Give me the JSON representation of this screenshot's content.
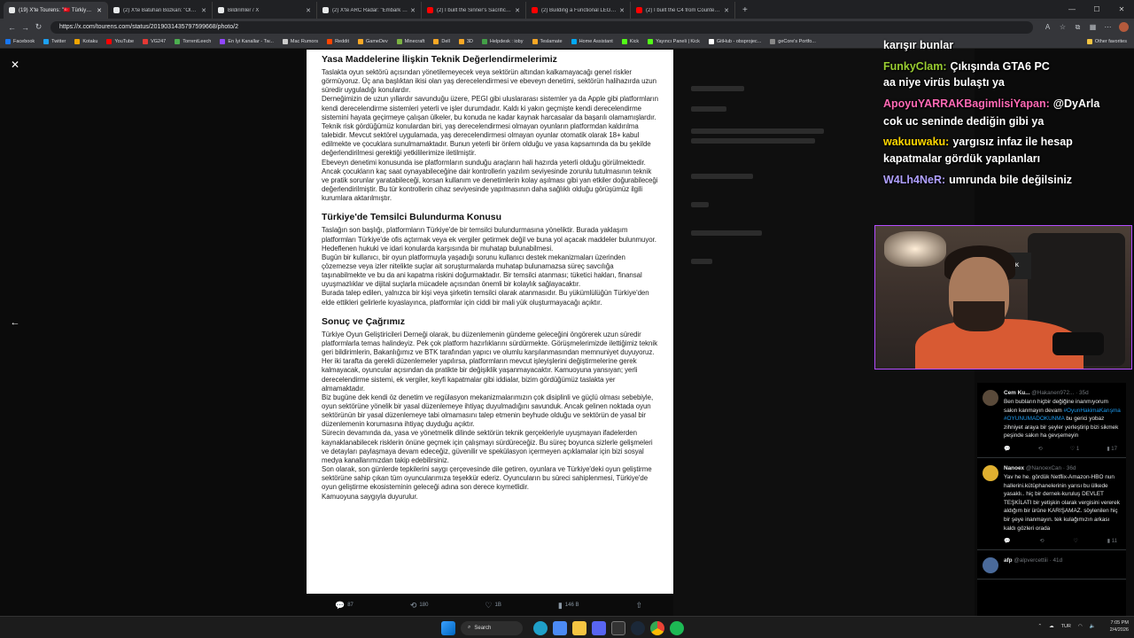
{
  "browser": {
    "tabs": [
      {
        "title": "(19) X'te Tourens: \"🇹🇷 Türkiye Oyun...",
        "active": true,
        "color": "#000000"
      },
      {
        "title": "(2) X'te Batuhan Bozkan: \"Olumlu...",
        "color": "#000000"
      },
      {
        "title": "Bildirimler / X",
        "color": "#000000"
      },
      {
        "title": "(2) X'te ARC Radar: \"Embark Studi...",
        "color": "#000000"
      },
      {
        "title": "(2) I built the Sinner's Sacrifice fro...",
        "color": "#ff0000"
      },
      {
        "title": "(2) Building a Functional LEGO Ty...",
        "color": "#ff0000"
      },
      {
        "title": "(2) I built the C4 from Counter-Str...",
        "color": "#ff0000"
      }
    ],
    "new_tab": "+",
    "url": "https://x.com/tourens.com/status/2019031435797599668/photo/2",
    "bookmarks": [
      {
        "label": "Facebook",
        "color": "#1877f2"
      },
      {
        "label": "Twitter",
        "color": "#1da1f2"
      },
      {
        "label": "Kotaku",
        "color": "#f0a500"
      },
      {
        "label": "YouTube",
        "color": "#ff0000"
      },
      {
        "label": "VG247",
        "color": "#e53935"
      },
      {
        "label": "TorrentLeech",
        "color": "#4caf50"
      },
      {
        "label": "En İyi Kanallar - Tw...",
        "color": "#9146ff"
      },
      {
        "label": "Mac Rumors",
        "color": "#cccccc"
      },
      {
        "label": "Reddit",
        "color": "#ff4500"
      },
      {
        "label": "GameDev",
        "color": "#f9a825"
      },
      {
        "label": "Minecraft",
        "color": "#7cb342"
      },
      {
        "label": "Dell",
        "color": "#f9a825"
      },
      {
        "label": "3D",
        "color": "#f9a825"
      },
      {
        "label": "Helpdesk : ioby",
        "color": "#43a047"
      },
      {
        "label": "Teslamate",
        "color": "#f9a825"
      },
      {
        "label": "Home Assistant",
        "color": "#03a9f4"
      },
      {
        "label": "Kick",
        "color": "#53fc18"
      },
      {
        "label": "Yayıncı Paneli | Kick",
        "color": "#53fc18"
      },
      {
        "label": "GitHub - obsprojec...",
        "color": "#ffffff"
      },
      {
        "label": "geCore's Portfo...",
        "color": "#888888"
      }
    ],
    "other_bookmarks": "Other favorites"
  },
  "document": {
    "sections": [
      {
        "heading": "Yasa Maddelerine İlişkin Teknik Değerlendirmelerimiz",
        "paragraphs": [
          "Taslakta oyun sektörü açısından yönetilemeyecek veya sektörün altından kalkamayacağı genel riskler görmüyoruz. Üç ana başlıktan ikisi olan yaş derecelendirmesi ve ebeveyn denetimi, sektörün halihazırda uzun süredir uyguladığı konulardır.",
          "Derneğimizin de uzun yıllardır savunduğu üzere, PEGI gibi uluslararası sistemler ya da Apple gibi platformların kendi derecelendirme sistemleri yeterli ve işler durumdadır. Kaldı ki yakın geçmişte kendi derecelendirme sistemini hayata geçirmeye çalışan ülkeler, bu konuda ne kadar kaynak harcasalar da başarılı olamamışlardır.",
          "Teknik risk gördüğümüz konulardan biri, yaş derecelendirmesi olmayan oyunların platformdan kaldırılma talebidir. Mevcut sektörel uygulamada, yaş derecelendirmesi olmayan oyunlar otomatik olarak 18+ kabul edilmekte ve çocuklara sunulmamaktadır. Bunun yeterli bir önlem olduğu ve yasa kapsamında da bu şekilde değerlendirilmesi gerektiği yetkililerimize iletilmiştir.",
          "Ebeveyn denetimi konusunda ise platformların sunduğu araçların hali hazırda yeterli olduğu görülmektedir. Ancak çocukların kaç saat oynayabileceğine dair kontrollerin yazılım seviyesinde zorunlu tutulmasının teknik ve pratik sorunlar yaratabileceği, korsan kullanım ve denetimlerin kolay aşılması gibi yan etkiler doğurabileceği değerlendirilmiştir. Bu tür kontrollerin cihaz seviyesinde yapılmasının daha sağlıklı olduğu görüşümüz ilgili kurumlara aktarılmıştır."
        ]
      },
      {
        "heading": "Türkiye'de Temsilci Bulundurma Konusu",
        "paragraphs": [
          "Taslağın son başlığı, platformların Türkiye'de bir temsilci bulundurmasına yöneliktir. Burada yaklaşım platformları Türkiye'de ofis açtırmak veya ek vergiler getirmek değil ve buna yol açacak maddeler bulunmuyor. Hedeflenen hukuki ve idari konularda karşısında bir muhatap bulunabilmesi.",
          "Bugün bir kullanıcı, bir oyun platformuyla yaşadığı sorunu kullanıcı destek mekanizmaları üzerinden çözemezse veya izler nitelikte suçlar ait soruşturmalarda muhatap bulunamazsa süreç savcılığa taşınabilmekte ve bu da ani kapatma riskini doğurmaktadır. Bir temsilci atanması; tüketici hakları, finansal uyuşmazlıklar ve dijital suçlarla mücadele açısından önemli bir kolaylık sağlayacaktır.",
          "Burada talep edilen, yalnızca bir kişi veya şirketin temsilci olarak atanmasıdır. Bu yükümlülüğün Türkiye'den elde ettikleri gelirlerle kıyaslayınca, platformlar için ciddi bir mali yük oluşturmayacağı açıktır."
        ]
      },
      {
        "heading": "Sonuç ve Çağrımız",
        "paragraphs": [
          "Türkiye Oyun Geliştiricileri Derneği olarak, bu düzenlemenin gündeme geleceğini öngörerek uzun süredir platformlarla temas halindeyiz. Pek çok platform hazırlıklarını sürdürmekte. Görüşmelerimizde ilettiğimiz teknik geri bildirimlerin, Bakanlığımız ve BTK tarafından yapıcı ve olumlu karşılanmasından memnuniyet duyuyoruz.",
          "Her iki tarafta da gerekli düzenlemeler yapılırsa, platformların mevcut işleyişlerini değiştirmelerine gerek kalmayacak, oyuncular açısından da pratikte bir değişiklik yaşanmayacaktır. Kamuoyuna yansıyan; yerli derecelendirme sistemi, ek vergiler, keyfi kapatmalar gibi iddialar, bizim gördüğümüz taslakta yer almamaktadır.",
          "Biz bugüne dek kendi öz denetim ve regülasyon mekanizmalarımızın çok disiplinli ve güçlü olması sebebiyle, oyun sektörüne yönelik bir yasal düzenlemeye ihtiyaç duyulmadığını savunduk. Ancak gelinen noktada oyun sektörünün bir yasal düzenlemeye tabi olmamasını talep etmenin beyhude olduğu ve sektörün de yasal bir düzenlemenin korumasına ihtiyaç duyduğu açıktır.",
          "Sürecin devamında da, yasa ve yönetmelik dilinde sektörün teknik gerçekleriyle uyuşmayan ifadelerden kaynaklanabilecek risklerin önüne geçmek için çalışmayı sürdüreceğiz. Bu süreç boyunca sizlerle gelişmeleri ve detayları paylaşmaya devam edeceğiz, güvenilir ve spekülasyon içermeyen açıklamalar için bizi sosyal medya kanallarımızdan takip edebilirsiniz.",
          "Son olarak, son günlerde tepkilerini saygı çerçevesinde dile getiren, oyunlara ve Türkiye'deki oyun geliştirme sektörüne sahip çıkan tüm oyuncularımıza teşekkür ederiz. Oyuncuların bu süreci sahiplenmesi, Türkiye'de oyun geliştirme ekosisteminin geleceği adına son derece kıymetlidir.",
          "Kamuoyuna saygıyla duyurulur."
        ]
      }
    ]
  },
  "tweet_actions": {
    "replies": "87",
    "retweets": "180",
    "likes": "1B",
    "views": "146 B"
  },
  "chat": [
    {
      "user": "",
      "message": "karışır bunlar",
      "color": "#ffffff"
    },
    {
      "user": "FunkyClam:",
      "message": "Çıkışında GTA6 PC",
      "color": "#9acd32"
    },
    {
      "user": "",
      "message": "aa niye virüs bulaştı ya",
      "color": "#ffffff"
    },
    {
      "user": "ApoyuYARRAKBagimlisiYapan:",
      "message": "@DyArla",
      "color": "#ff69b4"
    },
    {
      "user": "",
      "message": "cok uc seninde dediğin gibi ya",
      "color": "#ffffff"
    },
    {
      "user": "wakuuwaku:",
      "message": "yargısız infaz ile hesap",
      "color": "#ffd700"
    },
    {
      "user": "",
      "message": "kapatmalar gördük yapılanları",
      "color": "#ffffff"
    },
    {
      "user": "W4Lh4NeR:",
      "message": "umrunda bile değilsiniz",
      "color": "#b0a0ff"
    }
  ],
  "replies": [
    {
      "name": "Cem Ku...",
      "handle": "@Hakanen972... · 35d",
      "text": "Ben bubların hiçbir değiğine inanmıyorum sakın kanmayın devam",
      "tags": "#OyunHakimaKarışma #OYUNUMADOKUNMA",
      "text2": "bu gerici yobaz zihniyet araya bir şeyler yerleştirip bizi sikmek peşinde sakın ha gevşemeyin",
      "stats": [
        "",
        "",
        "1",
        "17"
      ],
      "avatar_color": "#5a4a3a"
    },
    {
      "name": "Nanoex",
      "handle": "@NanoexCan · 36d",
      "text": "Yav he he. gördük Netflix-Amazon-HBO nun hallerini.kütüphanelerinin yarısı bu ülkede yasaklı.. hiç bir dernek-kuruluş DEVLET TEŞKİLATI bir yetişkin olarak vergisini vererek aldığım bir ürüne KARIŞAMAZ. söylenilen hiç bir şeye inanmayın. tek kulağımızın arkası kaldı gözleri orada",
      "tags": "",
      "text2": "",
      "stats": [
        "",
        "",
        "",
        "11"
      ],
      "avatar_color": "#e0b030"
    },
    {
      "name": "afp",
      "handle": "@alpvercettiii · 41d",
      "text": "",
      "tags": "",
      "text2": "",
      "stats": [],
      "avatar_color": "#4a6a9a"
    }
  ],
  "taskbar": {
    "search": "Search",
    "lang": "TUR",
    "time": "7:05 PM",
    "date": "2/4/2026"
  }
}
